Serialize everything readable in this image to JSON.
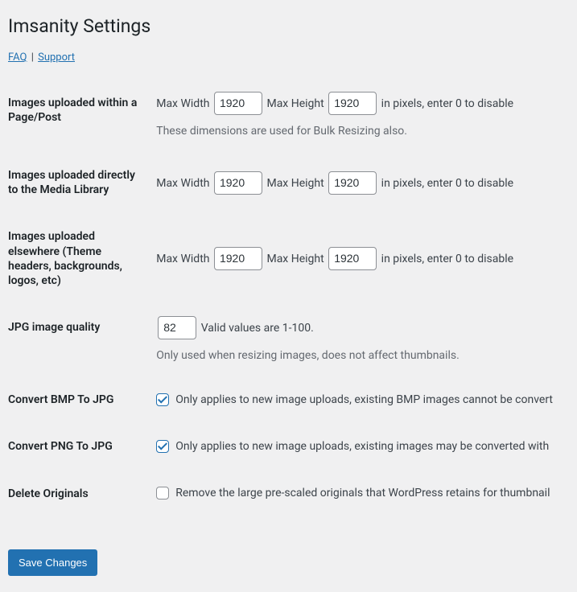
{
  "header": {
    "title": "Imsanity Settings",
    "faq_link": "FAQ",
    "support_link": "Support"
  },
  "labels": {
    "max_width": "Max Width",
    "max_height": "Max Height",
    "pixels_hint": "in pixels, enter 0 to disable"
  },
  "rows": {
    "page_post": {
      "label": "Images uploaded within a Page/Post",
      "width": "1920",
      "height": "1920",
      "description": "These dimensions are used for Bulk Resizing also."
    },
    "media_library": {
      "label": "Images uploaded directly to the Media Library",
      "width": "1920",
      "height": "1920"
    },
    "elsewhere": {
      "label": "Images uploaded elsewhere (Theme headers, backgrounds, logos, etc)",
      "width": "1920",
      "height": "1920"
    },
    "jpg_quality": {
      "label": "JPG image quality",
      "value": "82",
      "hint": "Valid values are 1-100.",
      "description": "Only used when resizing images, does not affect thumbnails."
    },
    "convert_bmp": {
      "label": "Convert BMP To JPG",
      "text": "Only applies to new image uploads, existing BMP images cannot be convert"
    },
    "convert_png": {
      "label": "Convert PNG To JPG",
      "text": "Only applies to new image uploads, existing images may be converted with "
    },
    "delete_originals": {
      "label": "Delete Originals",
      "text": "Remove the large pre-scaled originals that WordPress retains for thumbnail"
    }
  },
  "submit": {
    "label": "Save Changes"
  }
}
